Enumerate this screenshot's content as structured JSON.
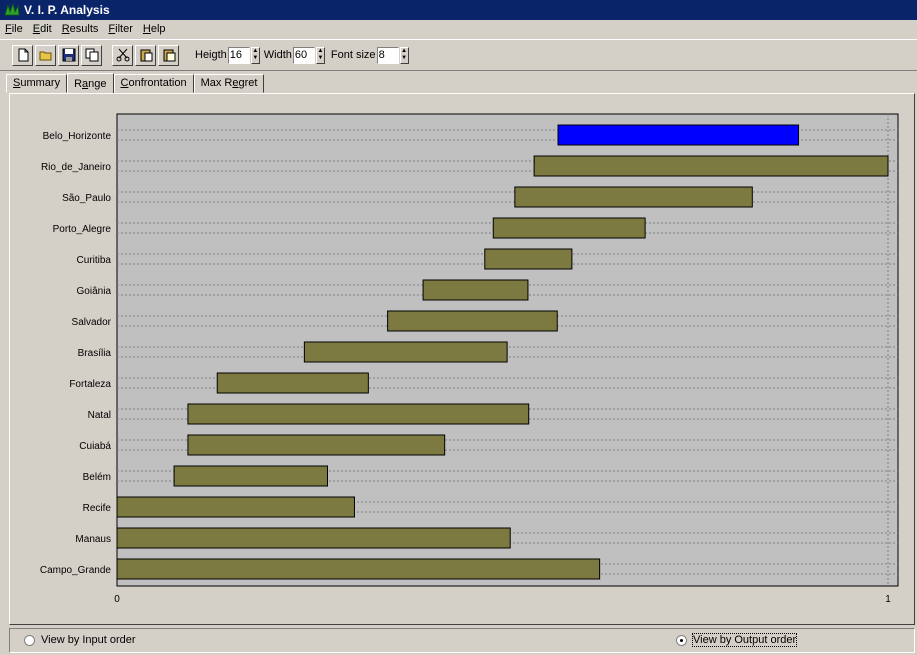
{
  "window": {
    "title": "V. I. P. Analysis"
  },
  "menu": [
    "File",
    "Edit",
    "Results",
    "Filter",
    "Help"
  ],
  "toolbar": {
    "buttons": [
      "new-icon",
      "open-icon",
      "save-icon",
      "copy-icon",
      "cut-icon",
      "paste-icon",
      "paste-special-icon"
    ],
    "height_label": "Heigth",
    "height_value": "16",
    "width_label": "Width",
    "width_value": "60",
    "font_size_label": "Font size",
    "font_size_value": "8"
  },
  "tabs": [
    "Summary",
    "Range",
    "Confrontation",
    "Max Regret"
  ],
  "active_tab": "Range",
  "chart_data": {
    "type": "range-bar",
    "xlim": [
      0,
      1
    ],
    "xticks": [
      "0",
      "1"
    ],
    "categories": [
      "Belo_Horizonte",
      "Rio_de_Janeiro",
      "São_Paulo",
      "Porto_Alegre",
      "Curitiba",
      "Goiânia",
      "Salvador",
      "Brasília",
      "Fortaleza",
      "Natal",
      "Cuiabá",
      "Belém",
      "Recife",
      "Manaus",
      "Campo_Grande"
    ],
    "ranges": [
      [
        0.572,
        0.884
      ],
      [
        0.541,
        1.0
      ],
      [
        0.516,
        0.824
      ],
      [
        0.488,
        0.685
      ],
      [
        0.477,
        0.59
      ],
      [
        0.397,
        0.533
      ],
      [
        0.351,
        0.571
      ],
      [
        0.243,
        0.506
      ],
      [
        0.13,
        0.326
      ],
      [
        0.092,
        0.534
      ],
      [
        0.092,
        0.425
      ],
      [
        0.074,
        0.273
      ],
      [
        0.0,
        0.308
      ],
      [
        0.0,
        0.51
      ],
      [
        0.0,
        0.626
      ]
    ],
    "colors": {
      "highlight": "#0000ff",
      "bar": "#7c7a40"
    },
    "highlighted": "Belo_Horizonte"
  },
  "view_options": {
    "input_label": "View by Input order",
    "output_label": "View by Output order",
    "selected": "output"
  }
}
